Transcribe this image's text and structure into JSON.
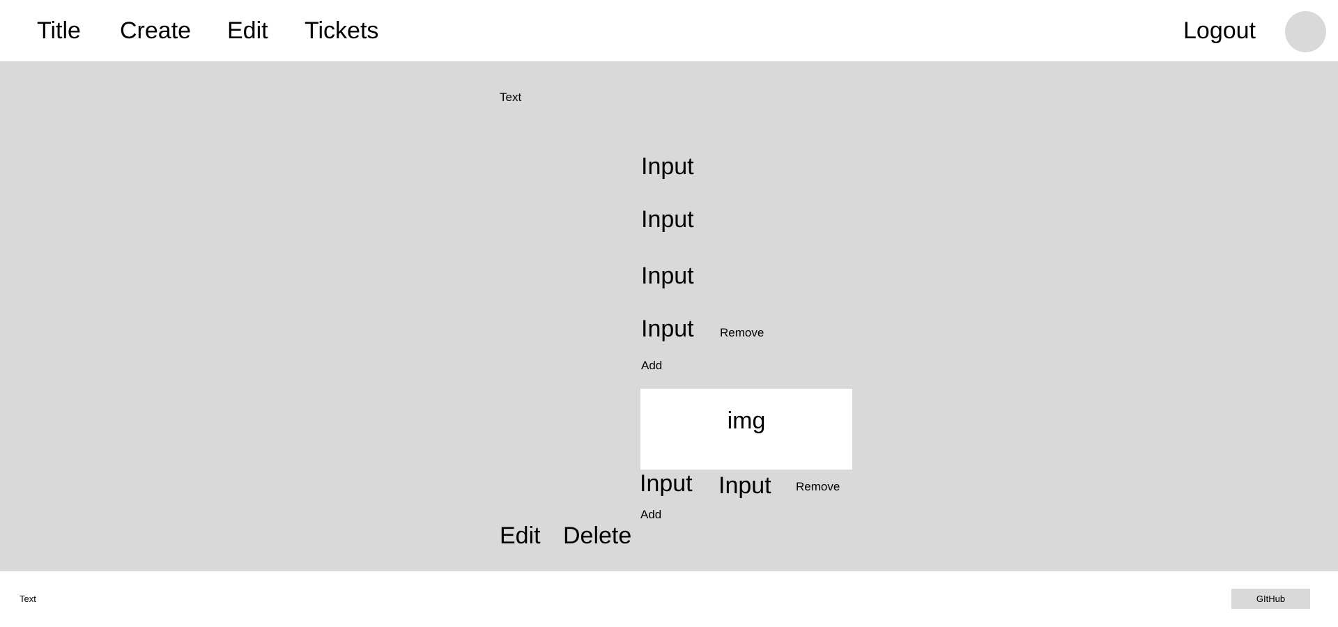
{
  "header": {
    "nav": {
      "title": "Title",
      "create": "Create",
      "edit": "Edit",
      "tickets": "Tickets"
    },
    "logout": "Logout"
  },
  "main": {
    "heading_text": "Text",
    "inputs": [
      "Input",
      "Input",
      "Input",
      "Input"
    ],
    "remove_label": "Remove",
    "add_label": "Add",
    "image_label": "img",
    "row_inputs": [
      "Input",
      "Input"
    ],
    "row_remove_label": "Remove",
    "row_add_label": "Add",
    "edit_label": "Edit",
    "delete_label": "Delete"
  },
  "footer": {
    "text": "Text",
    "github_label": "GItHub"
  }
}
